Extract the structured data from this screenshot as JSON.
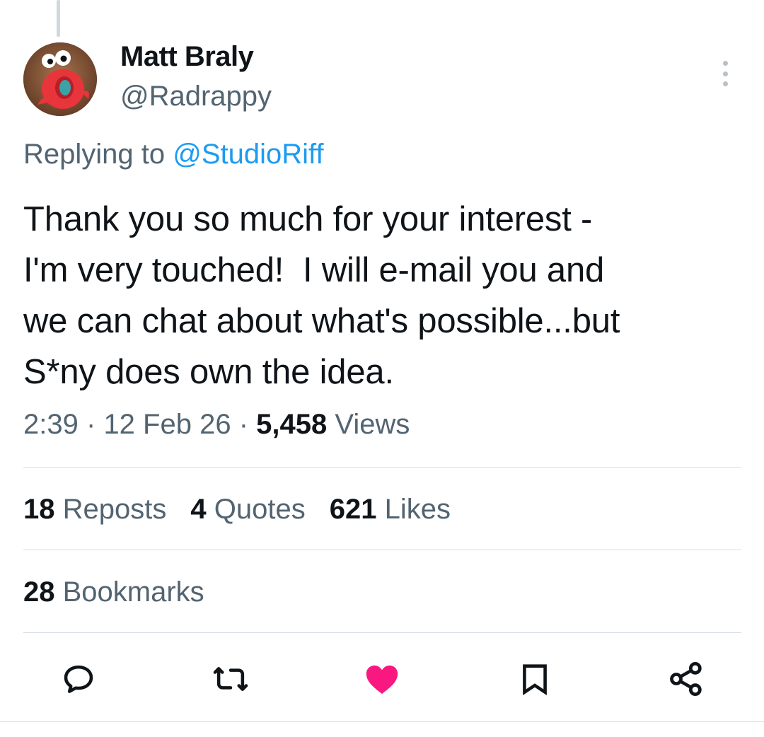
{
  "tweet": {
    "author_name": "Matt Braly",
    "author_handle": "@Radrappy",
    "replying_to_prefix": "Replying to",
    "replying_to_handle": "@StudioRiff",
    "text": "Thank you so much for your interest -\nI'm very touched!  I will e-mail you and\nwe can chat about what's possible...but\nS*ny does own the idea.",
    "time": "2:39",
    "date": "12 Feb 26",
    "separator": "·",
    "views_count": "5,458",
    "views_label": "Views"
  },
  "stats": {
    "reposts_count": "18",
    "reposts_label": "Reposts",
    "quotes_count": "4",
    "quotes_label": "Quotes",
    "likes_count": "621",
    "likes_label": "Likes",
    "bookmarks_count": "28",
    "bookmarks_label": "Bookmarks"
  },
  "actions": {
    "reply_icon": "reply-icon",
    "repost_icon": "repost-icon",
    "like_icon": "heart-icon",
    "like_active": true,
    "bookmark_icon": "bookmark-icon",
    "share_icon": "share-icon"
  },
  "colors": {
    "text_primary": "#0f1419",
    "text_secondary": "#536471",
    "link": "#1d9bf0",
    "like": "#f91880",
    "divider": "#d6dde2"
  }
}
